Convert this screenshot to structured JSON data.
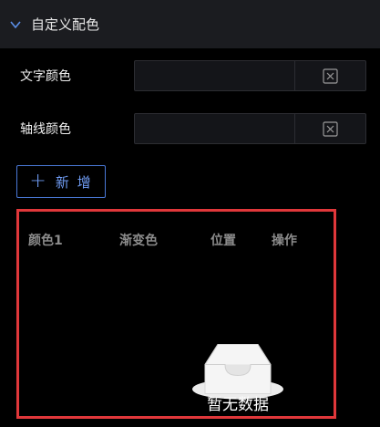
{
  "section": {
    "title": "自定义配色"
  },
  "form": {
    "text_color_label": "文字颜色",
    "axis_color_label": "轴线颜色"
  },
  "toolbar": {
    "add_label": "新 增"
  },
  "table": {
    "columns": [
      "颜色1",
      "渐变色",
      "位置",
      "操作"
    ],
    "rows": [],
    "empty_text": "暂无数据"
  },
  "colors": {
    "accent": "#4a79d8",
    "highlight_border": "#e0373a",
    "panel_bg": "#1b1c20"
  },
  "icons": {
    "collapse": "chevron-down-icon",
    "clear": "close-box-icon",
    "add": "plus-icon",
    "empty": "inbox-icon"
  }
}
